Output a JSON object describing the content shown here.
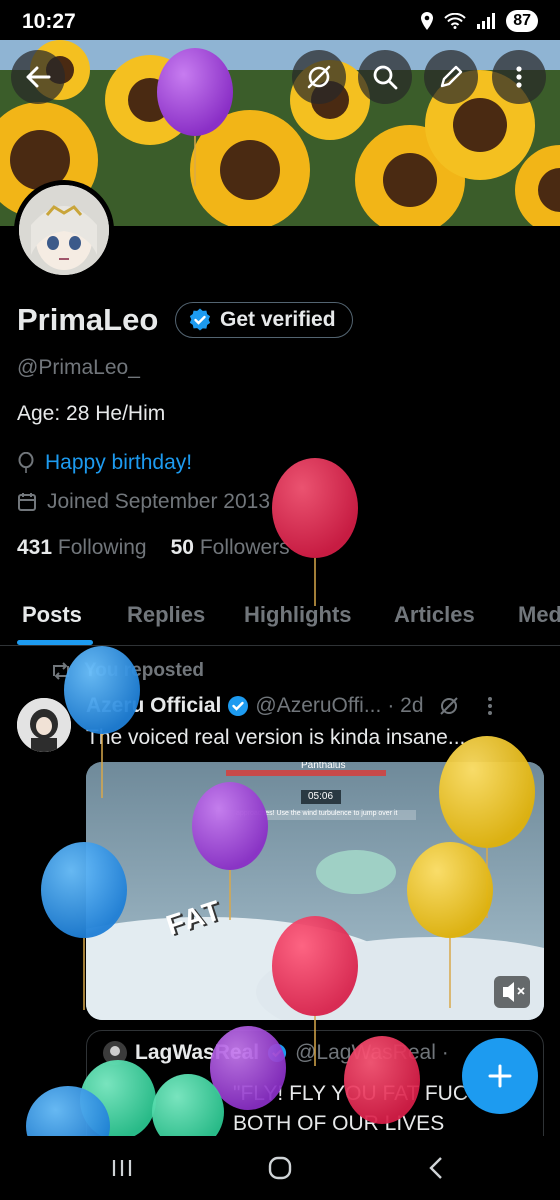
{
  "status_bar": {
    "time": "10:27",
    "battery": "87"
  },
  "header": {
    "back": "back",
    "grok": "grok",
    "search": "search",
    "edit": "edit",
    "more": "more"
  },
  "profile": {
    "name": "PrimaLeo",
    "verify_label": "Get verified",
    "handle": "@PrimaLeo_",
    "bio": "Age: 28  He/Him",
    "birthday": "Happy birthday!",
    "joined": "Joined September 2013",
    "following_count": "431",
    "following_label": "Following",
    "followers_count": "50",
    "followers_label": "Followers"
  },
  "tabs": [
    "Posts",
    "Replies",
    "Highlights",
    "Articles",
    "Media"
  ],
  "post": {
    "repost_label": "You reposted",
    "author": "Azeru Official",
    "handle": "@AzeruOffi...",
    "time": "· 2d",
    "text": "The voiced real version is kinda insane...",
    "media": {
      "boss_name": "Panthalus",
      "timer": "05:06",
      "warning": "approaches! Use the wind turbulence to jump over it",
      "overlay_text": "FAT"
    },
    "quote": {
      "author": "LagWasReal",
      "handle": "@LagWasReal ·",
      "line1": "\"FLY! FLY YOU FAT FUC",
      "line2": "BOTH OF OUR LIVES"
    }
  },
  "colors": {
    "accent": "#1d9bf0",
    "background": "#000000",
    "muted": "#71767b"
  }
}
